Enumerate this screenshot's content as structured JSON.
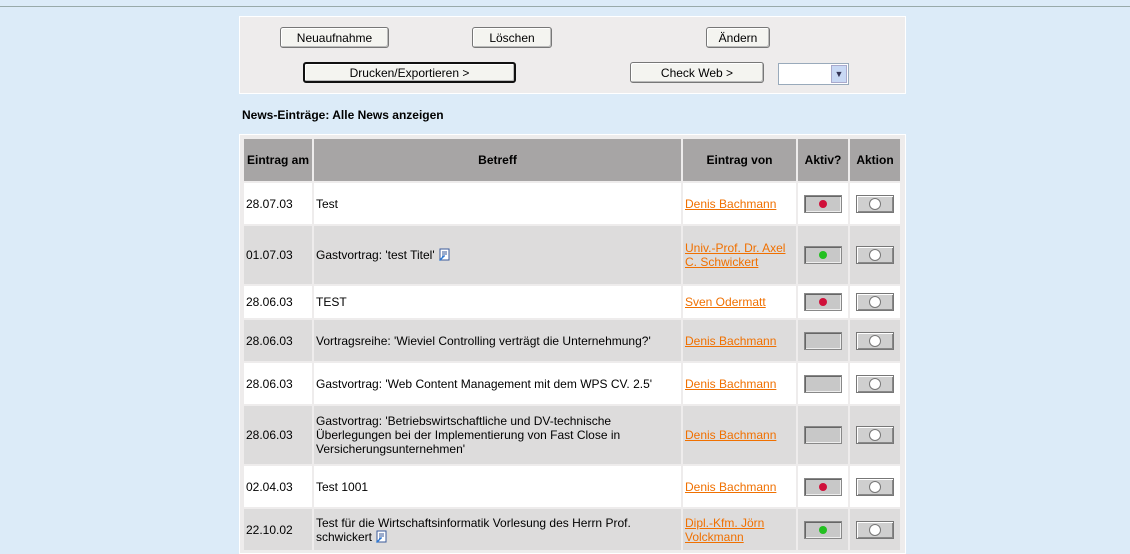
{
  "toolbar": {
    "new_label": "Neuaufnahme",
    "delete_label": "Löschen",
    "edit_label": "Ändern",
    "print_label": "Drucken/Exportieren >",
    "checkweb_label": "Check Web >",
    "select_value": ""
  },
  "section": {
    "title": "News-Einträge:  Alle News anzeigen"
  },
  "table": {
    "headers": [
      "Eintrag am",
      "Betreff",
      "Eintrag von",
      "Aktiv?",
      "Aktion"
    ],
    "rows": [
      {
        "date": "28.07.03",
        "subject": "Test",
        "author": "Denis Bachmann",
        "active": "red",
        "icon": false
      },
      {
        "date": "01.07.03",
        "subject": "Gastvortrag: 'test Titel'",
        "author": "Univ.-Prof. Dr. Axel C. Schwickert",
        "active": "green",
        "icon": true
      },
      {
        "date": "28.06.03",
        "subject": "TEST",
        "author": "Sven Odermatt",
        "active": "red",
        "icon": false
      },
      {
        "date": "28.06.03",
        "subject": "Vortragsreihe: 'Wieviel Controlling verträgt die Unternehmung?'",
        "author": "Denis Bachmann",
        "active": "none",
        "icon": false
      },
      {
        "date": "28.06.03",
        "subject": "Gastvortrag: 'Web Content Management mit dem WPS CV. 2.5'",
        "author": "Denis Bachmann",
        "active": "none",
        "icon": false
      },
      {
        "date": "28.06.03",
        "subject": "Gastvortrag: 'Betriebswirtschaftliche und DV-technische Überlegungen bei der Implementierung von Fast Close in Versicherungsunternehmen'",
        "author": "Denis Bachmann",
        "active": "none",
        "icon": false
      },
      {
        "date": "02.04.03",
        "subject": "Test 1001",
        "author": "Denis Bachmann",
        "active": "red",
        "icon": false
      },
      {
        "date": "22.10.02",
        "subject": "Test für die Wirtschaftsinformatik Vorlesung des Herrn Prof. schwickert",
        "author": "Dipl.-Kfm. Jörn Volckmann",
        "active": "green",
        "icon": true
      }
    ]
  },
  "colors": {
    "red_dot": "#d0103a",
    "green_dot": "#22c020",
    "link": "#f07000",
    "page_bg": "#dcebf8"
  },
  "icons": {
    "edit_doc": "document-pencil-icon",
    "radio": "radio-icon",
    "status": "status-dot-icon"
  }
}
